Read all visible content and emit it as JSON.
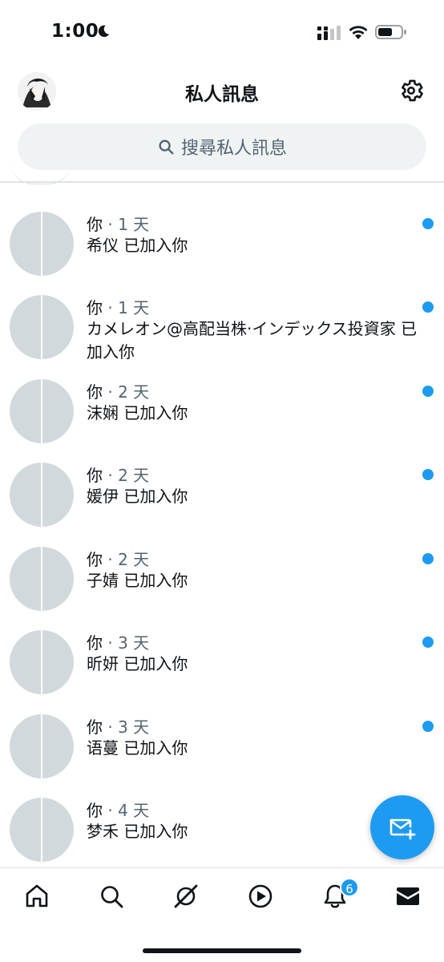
{
  "status_bar": {
    "time": "1:00"
  },
  "header": {
    "title": "私人訊息"
  },
  "search": {
    "placeholder": "搜尋私人訊息"
  },
  "conversations": [
    {
      "sender": "你",
      "separator": " · ",
      "time": "1 天",
      "message": "希仪 已加入你",
      "unread": true
    },
    {
      "sender": "你",
      "separator": " · ",
      "time": "1 天",
      "message": "カメレオン@高配当株·インデックス投資家 已加入你",
      "unread": true
    },
    {
      "sender": "你",
      "separator": " · ",
      "time": "2 天",
      "message": "沫娴 已加入你",
      "unread": true
    },
    {
      "sender": "你",
      "separator": " · ",
      "time": "2 天",
      "message": "媛伊 已加入你",
      "unread": true
    },
    {
      "sender": "你",
      "separator": " · ",
      "time": "2 天",
      "message": "子婧 已加入你",
      "unread": true
    },
    {
      "sender": "你",
      "separator": " · ",
      "time": "3 天",
      "message": "昕妍 已加入你",
      "unread": true
    },
    {
      "sender": "你",
      "separator": " · ",
      "time": "3 天",
      "message": "语蔓 已加入你",
      "unread": true
    },
    {
      "sender": "你",
      "separator": " · ",
      "time": "4 天",
      "message": "梦禾 已加入你",
      "unread": false
    }
  ],
  "bottom_nav": {
    "items": [
      "home-icon",
      "search-icon",
      "spaces-icon",
      "video-icon",
      "notifications-icon",
      "messages-icon"
    ],
    "notifications_badge": "6"
  },
  "colors": {
    "accent": "#1d9bf0",
    "avatar_placeholder": "#d1d9dd",
    "secondary_text": "#536471"
  }
}
